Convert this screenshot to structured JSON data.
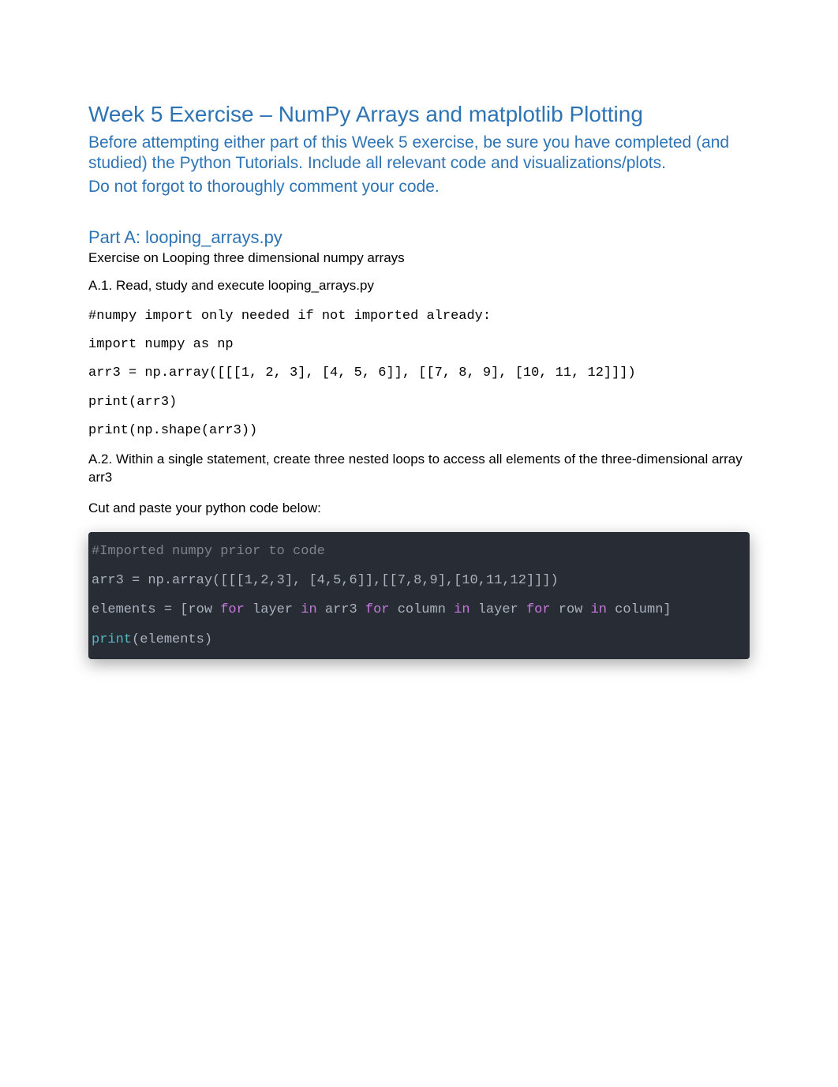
{
  "title": "Week 5 Exercise – NumPy Arrays and matplotlib Plotting",
  "intro_p1": "Before attempting either part of this Week 5 exercise, be sure you have completed (and studied) the Python Tutorials.  Include all relevant code and visualizations/plots.",
  "intro_p2": "Do not forgot to thoroughly comment your code.",
  "partA": {
    "heading": "Part A: looping_arrays.py",
    "subtitle": "Exercise on Looping three dimensional numpy arrays",
    "a1": "A.1. Read, study and execute looping_arrays.py",
    "code1": "#numpy import only needed if not imported already:",
    "code2": "import numpy as np",
    "code3": "arr3 = np.array([[[1, 2, 3], [4, 5, 6]], [[7, 8, 9], [10, 11, 12]]])",
    "code4": "print(arr3)",
    "code5": "print(np.shape(arr3))",
    "a2": "A.2. Within a single statement, create three nested loops to access all elements of the three-dimensional array arr3",
    "cutpaste": "Cut and paste your python code below:"
  },
  "code_block": {
    "l1": "#Imported numpy prior to code",
    "l2_a": "arr3 = np.array([[[",
    "l2_b": "1",
    "l2_c": ",",
    "l2_d": "2",
    "l2_e": ",",
    "l2_f": "3",
    "l2_g": "], [",
    "l2_h": "4",
    "l2_i": ",",
    "l2_j": "5",
    "l2_k": ",",
    "l2_l": "6",
    "l2_m": "]],[[",
    "l2_n": "7",
    "l2_o": ",",
    "l2_p": "8",
    "l2_q": ",",
    "l2_r": "9",
    "l2_s": "],[",
    "l2_t": "10",
    "l2_u": ",",
    "l2_v": "11",
    "l2_w": ",",
    "l2_x": "12",
    "l2_y": "]]])",
    "l3_a": "elements = [row ",
    "l3_for": "for",
    "l3_b": " layer ",
    "l3_in": "in",
    "l3_c": " arr3 ",
    "l3_d": " column ",
    "l3_e": " layer ",
    "l3_f": " row ",
    "l3_g": " column]",
    "l4_print": "print",
    "l4_rest": "(elements)"
  }
}
